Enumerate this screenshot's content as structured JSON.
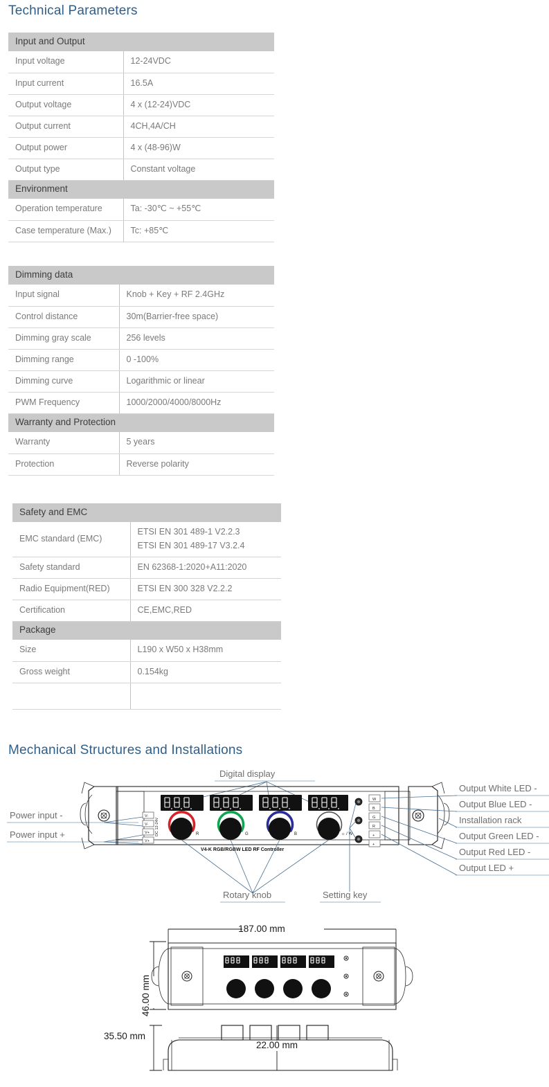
{
  "headings": {
    "technical": "Technical Parameters",
    "mechanical": "Mechanical Structures and Installations"
  },
  "colors": {
    "heading_blue": "#2e5f8a",
    "band_gray": "#c9c9c9",
    "body_text": "#7a7a7a",
    "leader_blue": "#4a6f92"
  },
  "tables": [
    {
      "id": "input-output",
      "sections": [
        {
          "band": "Input and Output",
          "rows": [
            {
              "label": "Input voltage",
              "value": "12-24VDC"
            },
            {
              "label": "Input current",
              "value": "16.5A"
            },
            {
              "label": "Output voltage",
              "value": "4 x (12-24)VDC"
            },
            {
              "label": "Output current",
              "value": "4CH,4A/CH"
            },
            {
              "label": "Output power",
              "value": "4 x (48-96)W"
            },
            {
              "label": "Output type",
              "value": "Constant voltage"
            }
          ]
        },
        {
          "band": "Environment",
          "rows": [
            {
              "label": "Operation temperature",
              "value": "Ta: -30℃ ~ +55℃"
            },
            {
              "label": "Case temperature (Max.)",
              "value": "Tc: +85℃"
            }
          ]
        }
      ]
    },
    {
      "id": "dimming",
      "sections": [
        {
          "band": "Dimming data",
          "rows": [
            {
              "label": "Input signal",
              "value": "Knob + Key + RF 2.4GHz"
            },
            {
              "label": "Control distance",
              "value": "30m(Barrier-free space)"
            },
            {
              "label": "Dimming gray scale",
              "value": "256 levels"
            },
            {
              "label": "Dimming range",
              "value": "0 -100%"
            },
            {
              "label": "Dimming curve",
              "value": "Logarithmic or linear"
            },
            {
              "label": "PWM Frequency",
              "value": "1000/2000/4000/8000Hz"
            }
          ]
        },
        {
          "band": "Warranty and Protection",
          "rows": [
            {
              "label": "Warranty",
              "value": "5 years"
            },
            {
              "label": "Protection",
              "value": "Reverse polarity"
            }
          ]
        }
      ]
    },
    {
      "id": "safety-package",
      "sections": [
        {
          "band": "Safety and EMC",
          "rows": [
            {
              "label": "EMC standard (EMC)",
              "value_lines": [
                "ETSI EN 301 489-1 V2.2.3",
                "ETSI EN 301 489-17 V3.2.4"
              ]
            },
            {
              "label": "Safety standard",
              "value": "EN 62368-1:2020+A11:2020"
            },
            {
              "label": "Radio Equipment(RED)",
              "value": "ETSI EN 300 328 V2.2.2"
            },
            {
              "label": "Certification",
              "value": "CE,EMC,RED"
            }
          ]
        },
        {
          "band": "Package",
          "rows": [
            {
              "label": "Size",
              "value": "L190 x W50 x H38mm"
            },
            {
              "label": "Gross weight",
              "value": "0.154kg"
            },
            {
              "label": "",
              "value": ""
            }
          ]
        }
      ]
    }
  ],
  "diagram": {
    "callouts_top": [
      "Digital display"
    ],
    "callouts_left": [
      "Power input -",
      "Power input +"
    ],
    "callouts_right": [
      "Output White LED -",
      "Output Blue LED -",
      "Installation rack",
      "Output Green LED -",
      "Output Red LED -",
      "Output LED +"
    ],
    "callouts_bottom": [
      "Rotary knob",
      "Setting key"
    ],
    "device": {
      "model_text": "V4-K   RGB/RGBW LED RF Controller",
      "knob_labels": [
        "R",
        "G",
        "B",
        "☼ / W"
      ],
      "input_terminals": [
        "V-",
        "V-",
        "V+",
        "V+"
      ],
      "input_terminal_note": "DC 12-24V",
      "output_terminals": [
        "W",
        "B",
        "G",
        "R",
        "+",
        "+"
      ],
      "display_count": 4,
      "display_digits": "888"
    }
  },
  "dimensions": {
    "width": "187.00 mm",
    "height": "46.00 mm",
    "depth": "35.50 mm",
    "inner": "22.00 mm"
  }
}
